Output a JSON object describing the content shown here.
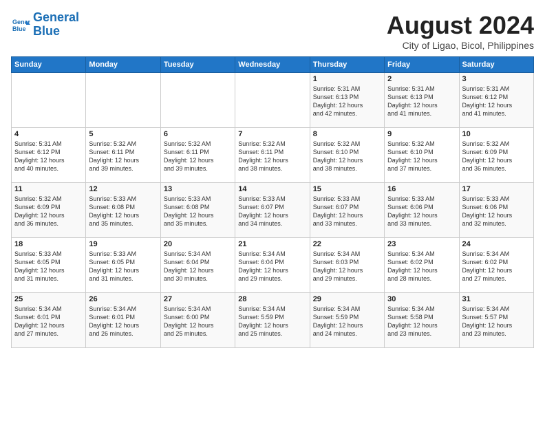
{
  "logo": {
    "line1": "General",
    "line2": "Blue"
  },
  "title": "August 2024",
  "subtitle": "City of Ligao, Bicol, Philippines",
  "days_of_week": [
    "Sunday",
    "Monday",
    "Tuesday",
    "Wednesday",
    "Thursday",
    "Friday",
    "Saturday"
  ],
  "weeks": [
    [
      {
        "day": "",
        "info": ""
      },
      {
        "day": "",
        "info": ""
      },
      {
        "day": "",
        "info": ""
      },
      {
        "day": "",
        "info": ""
      },
      {
        "day": "1",
        "info": "Sunrise: 5:31 AM\nSunset: 6:13 PM\nDaylight: 12 hours\nand 42 minutes."
      },
      {
        "day": "2",
        "info": "Sunrise: 5:31 AM\nSunset: 6:13 PM\nDaylight: 12 hours\nand 41 minutes."
      },
      {
        "day": "3",
        "info": "Sunrise: 5:31 AM\nSunset: 6:12 PM\nDaylight: 12 hours\nand 41 minutes."
      }
    ],
    [
      {
        "day": "4",
        "info": "Sunrise: 5:31 AM\nSunset: 6:12 PM\nDaylight: 12 hours\nand 40 minutes."
      },
      {
        "day": "5",
        "info": "Sunrise: 5:32 AM\nSunset: 6:11 PM\nDaylight: 12 hours\nand 39 minutes."
      },
      {
        "day": "6",
        "info": "Sunrise: 5:32 AM\nSunset: 6:11 PM\nDaylight: 12 hours\nand 39 minutes."
      },
      {
        "day": "7",
        "info": "Sunrise: 5:32 AM\nSunset: 6:11 PM\nDaylight: 12 hours\nand 38 minutes."
      },
      {
        "day": "8",
        "info": "Sunrise: 5:32 AM\nSunset: 6:10 PM\nDaylight: 12 hours\nand 38 minutes."
      },
      {
        "day": "9",
        "info": "Sunrise: 5:32 AM\nSunset: 6:10 PM\nDaylight: 12 hours\nand 37 minutes."
      },
      {
        "day": "10",
        "info": "Sunrise: 5:32 AM\nSunset: 6:09 PM\nDaylight: 12 hours\nand 36 minutes."
      }
    ],
    [
      {
        "day": "11",
        "info": "Sunrise: 5:32 AM\nSunset: 6:09 PM\nDaylight: 12 hours\nand 36 minutes."
      },
      {
        "day": "12",
        "info": "Sunrise: 5:33 AM\nSunset: 6:08 PM\nDaylight: 12 hours\nand 35 minutes."
      },
      {
        "day": "13",
        "info": "Sunrise: 5:33 AM\nSunset: 6:08 PM\nDaylight: 12 hours\nand 35 minutes."
      },
      {
        "day": "14",
        "info": "Sunrise: 5:33 AM\nSunset: 6:07 PM\nDaylight: 12 hours\nand 34 minutes."
      },
      {
        "day": "15",
        "info": "Sunrise: 5:33 AM\nSunset: 6:07 PM\nDaylight: 12 hours\nand 33 minutes."
      },
      {
        "day": "16",
        "info": "Sunrise: 5:33 AM\nSunset: 6:06 PM\nDaylight: 12 hours\nand 33 minutes."
      },
      {
        "day": "17",
        "info": "Sunrise: 5:33 AM\nSunset: 6:06 PM\nDaylight: 12 hours\nand 32 minutes."
      }
    ],
    [
      {
        "day": "18",
        "info": "Sunrise: 5:33 AM\nSunset: 6:05 PM\nDaylight: 12 hours\nand 31 minutes."
      },
      {
        "day": "19",
        "info": "Sunrise: 5:33 AM\nSunset: 6:05 PM\nDaylight: 12 hours\nand 31 minutes."
      },
      {
        "day": "20",
        "info": "Sunrise: 5:34 AM\nSunset: 6:04 PM\nDaylight: 12 hours\nand 30 minutes."
      },
      {
        "day": "21",
        "info": "Sunrise: 5:34 AM\nSunset: 6:04 PM\nDaylight: 12 hours\nand 29 minutes."
      },
      {
        "day": "22",
        "info": "Sunrise: 5:34 AM\nSunset: 6:03 PM\nDaylight: 12 hours\nand 29 minutes."
      },
      {
        "day": "23",
        "info": "Sunrise: 5:34 AM\nSunset: 6:02 PM\nDaylight: 12 hours\nand 28 minutes."
      },
      {
        "day": "24",
        "info": "Sunrise: 5:34 AM\nSunset: 6:02 PM\nDaylight: 12 hours\nand 27 minutes."
      }
    ],
    [
      {
        "day": "25",
        "info": "Sunrise: 5:34 AM\nSunset: 6:01 PM\nDaylight: 12 hours\nand 27 minutes."
      },
      {
        "day": "26",
        "info": "Sunrise: 5:34 AM\nSunset: 6:01 PM\nDaylight: 12 hours\nand 26 minutes."
      },
      {
        "day": "27",
        "info": "Sunrise: 5:34 AM\nSunset: 6:00 PM\nDaylight: 12 hours\nand 25 minutes."
      },
      {
        "day": "28",
        "info": "Sunrise: 5:34 AM\nSunset: 5:59 PM\nDaylight: 12 hours\nand 25 minutes."
      },
      {
        "day": "29",
        "info": "Sunrise: 5:34 AM\nSunset: 5:59 PM\nDaylight: 12 hours\nand 24 minutes."
      },
      {
        "day": "30",
        "info": "Sunrise: 5:34 AM\nSunset: 5:58 PM\nDaylight: 12 hours\nand 23 minutes."
      },
      {
        "day": "31",
        "info": "Sunrise: 5:34 AM\nSunset: 5:57 PM\nDaylight: 12 hours\nand 23 minutes."
      }
    ]
  ]
}
